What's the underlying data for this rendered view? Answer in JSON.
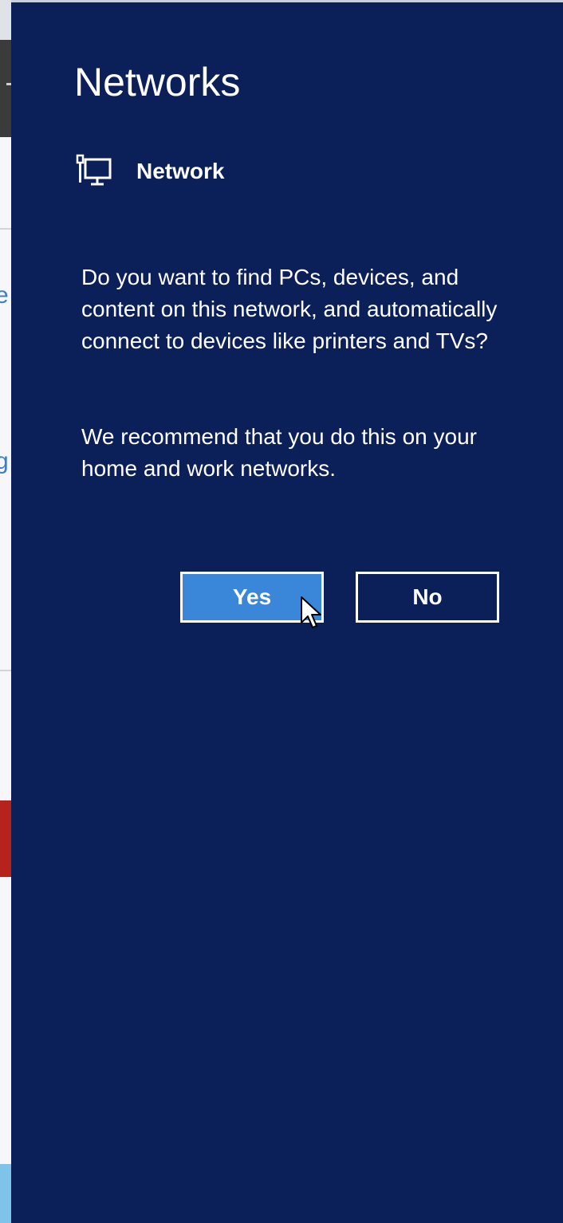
{
  "panel": {
    "title": "Networks",
    "network": {
      "icon": "wired-network-icon",
      "name": "Network"
    },
    "prompt": "Do you want to find PCs, devices, and content on this network, and automatically connect to devices like printers and TVs?",
    "recommendation": "We recommend that you do this on your home and work networks.",
    "buttons": {
      "yes_label": "Yes",
      "no_label": "No"
    }
  },
  "background_app": {
    "letter_1": "e",
    "letter_2": "g"
  },
  "colors": {
    "panel_background": "#0b1f59",
    "accent_button": "#3a86d9",
    "text": "#ffffff"
  }
}
